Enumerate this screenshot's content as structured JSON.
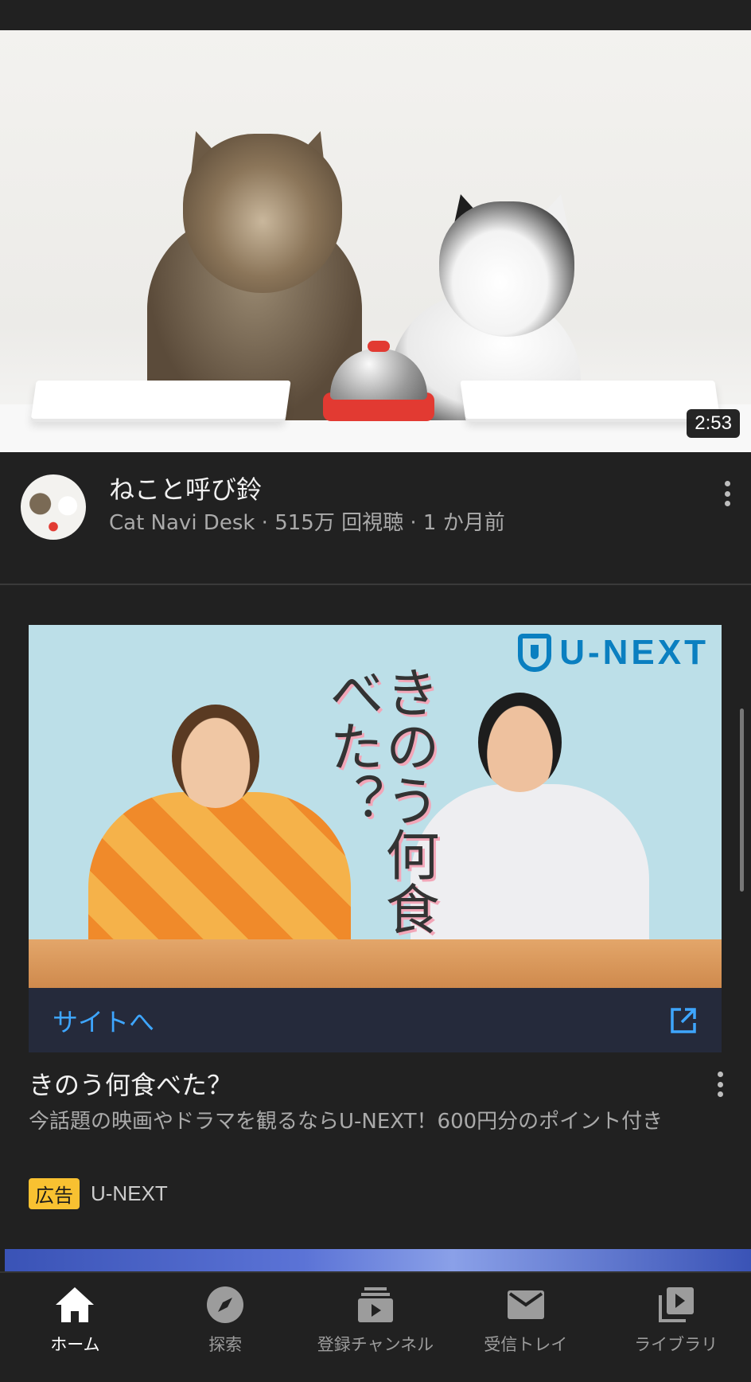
{
  "video": {
    "duration": "2:53",
    "title": "ねこと呼び鈴",
    "subtitle": "Cat Navi Desk · 515万 回視聴 · 1 か月前"
  },
  "ad": {
    "brand_logo_text": "U-NEXT",
    "art_title": "きのう何食べた？",
    "cta_label": "サイトへ",
    "title": "きのう何食べた？",
    "description": "今話題の映画やドラマを観るならU-NEXT！600円分のポイント付き",
    "badge": "広告",
    "advertiser": "U-NEXT"
  },
  "nav": {
    "items": [
      {
        "label": "ホーム",
        "icon": "home-icon",
        "active": true
      },
      {
        "label": "探索",
        "icon": "explore-icon",
        "active": false
      },
      {
        "label": "登録チャンネル",
        "icon": "subscriptions-icon",
        "active": false
      },
      {
        "label": "受信トレイ",
        "icon": "inbox-icon",
        "active": false
      },
      {
        "label": "ライブラリ",
        "icon": "library-icon",
        "active": false
      }
    ]
  },
  "colors": {
    "background": "#212121",
    "link_blue": "#3ea6ff",
    "ad_badge": "#f8c131",
    "unext_blue": "#0a7fc0"
  }
}
